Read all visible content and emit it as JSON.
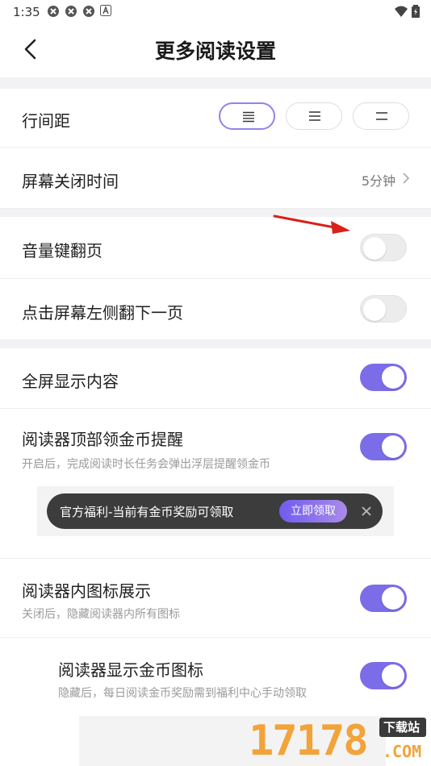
{
  "status_bar": {
    "time": "1:35",
    "left_icons": [
      "app-icon",
      "app-icon",
      "app-icon",
      "a-badge-icon"
    ],
    "right_icons": [
      "wifi-icon",
      "battery-icon"
    ]
  },
  "nav": {
    "title": "更多阅读设置",
    "back_icon": "chevron-left-icon"
  },
  "settings": {
    "line_spacing": {
      "label": "行间距",
      "options": [
        "dense",
        "medium",
        "loose"
      ],
      "selected_index": 0
    },
    "screen_off": {
      "label": "屏幕关闭时间",
      "value": "5分钟"
    },
    "volume_key": {
      "label": "音量键翻页",
      "on": false
    },
    "tap_left": {
      "label": "点击屏幕左侧翻下一页",
      "on": false
    },
    "fullscreen": {
      "label": "全屏显示内容",
      "on": true
    },
    "coin_reminder": {
      "label": "阅读器顶部领金币提醒",
      "sub": "开启后，完成阅读时长任务会弹出浮层提醒领金币",
      "on": true
    },
    "toast_preview": {
      "text": "官方福利-当前有金币奖励可领取",
      "button": "立即领取"
    },
    "icon_display": {
      "label": "阅读器内图标展示",
      "sub": "关闭后，隐藏阅读器内所有图标",
      "on": true
    },
    "coin_icon": {
      "label": "阅读器显示金币图标",
      "sub": "隐藏后，每日阅读金币奖励需到福利中心手动领取",
      "on": true
    }
  },
  "watermark": {
    "number": "17178",
    "tag": "下载站",
    "suffix": ".COM"
  },
  "colors": {
    "accent": "#7b6ce8",
    "toggle_off": "#ececec",
    "annotation_arrow": "#d9201b",
    "watermark": "#f2a33a"
  }
}
